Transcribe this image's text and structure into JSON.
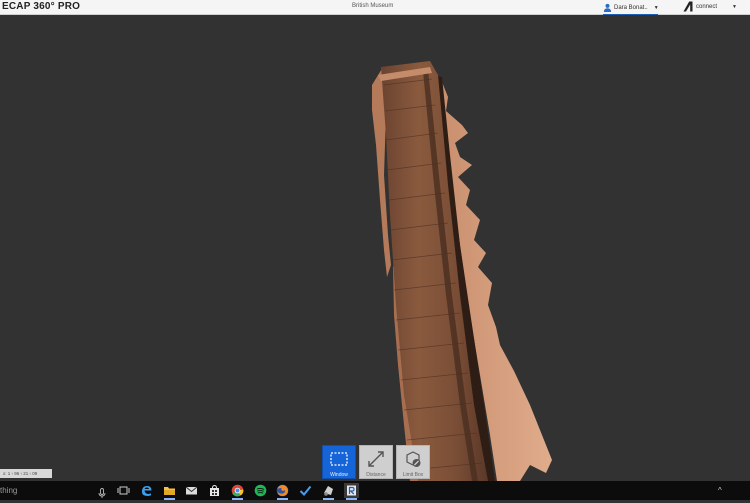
{
  "titlebar": {
    "app_title": "ECAP 360° PRO",
    "project_name": "British Museum",
    "user_name": "Dara Bonat..",
    "connect_label": "connect"
  },
  "viewport": {
    "background": "#323232",
    "scan_colors": {
      "base": "#8a5a3c",
      "highlight": "#d39f82",
      "dark": "#3a2418"
    }
  },
  "toolbar": {
    "tools": [
      {
        "label": "Window",
        "icon": "window-select-icon",
        "active": true
      },
      {
        "label": "Distance",
        "icon": "distance-measure-icon",
        "active": false
      },
      {
        "label": "Limit Box",
        "icon": "limit-box-icon",
        "active": false
      }
    ]
  },
  "status": {
    "coordinates": "x: 1 ‹ 96 ‹ 21 ‹ 09"
  },
  "taskbar": {
    "search_text": "thing",
    "icons": [
      "task-view-icon",
      "edge-icon",
      "file-explorer-icon",
      "mail-icon",
      "store-icon",
      "chrome-icon",
      "spotify-icon",
      "firefox-icon",
      "todo-icon",
      "recap-photo-icon",
      "recap-pro-icon"
    ],
    "tray_symbol": "^"
  }
}
